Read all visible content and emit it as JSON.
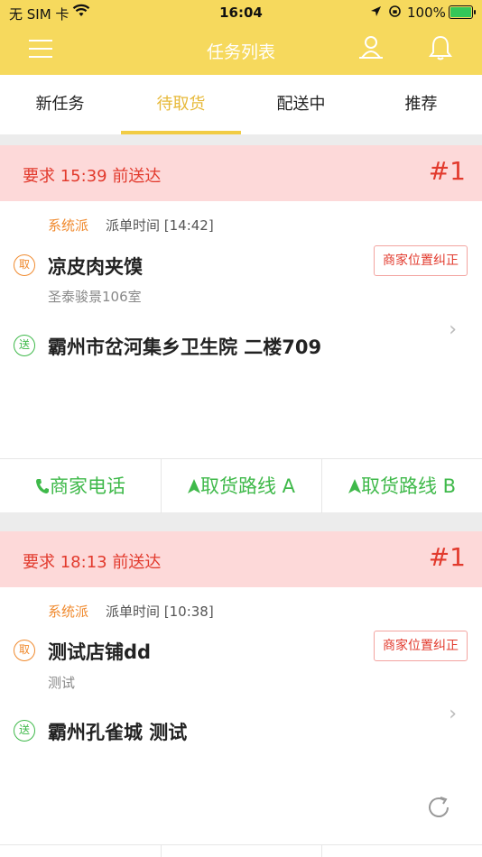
{
  "status": {
    "carrier": "无 SIM 卡",
    "time": "16:04",
    "battery": "100%"
  },
  "nav": {
    "title": "任务列表"
  },
  "tabs": [
    {
      "label": "新任务"
    },
    {
      "label": "待取货"
    },
    {
      "label": "配送中"
    },
    {
      "label": "推荐"
    }
  ],
  "orders": [
    {
      "deadline": "要求 15:39 前送达",
      "number": "#1",
      "dispatch_source": "系统派",
      "dispatch_time": "派单时间 [14:42]",
      "pickup_badge": "取",
      "shop_name": "凉皮肉夹馍",
      "shop_address": "圣泰骏景106室",
      "fix_location": "商家位置纠正",
      "delivery_badge": "送",
      "destination": "霸州市岔河集乡卫生院 二楼709",
      "actions": [
        "商家电话",
        "取货路线 A",
        "取货路线 B"
      ]
    },
    {
      "deadline": "要求 18:13 前送达",
      "number": "#1",
      "dispatch_source": "系统派",
      "dispatch_time": "派单时间 [10:38]",
      "pickup_badge": "取",
      "shop_name": "测试店铺dd",
      "shop_address": "测试",
      "fix_location": "商家位置纠正",
      "delivery_badge": "送",
      "destination": "霸州孔雀城 测试"
    }
  ],
  "colors": {
    "accent_yellow": "#f6d95d",
    "deadline_red": "#e23a2d",
    "action_green": "#3fb94a",
    "dispatch_orange": "#f08a2e"
  }
}
